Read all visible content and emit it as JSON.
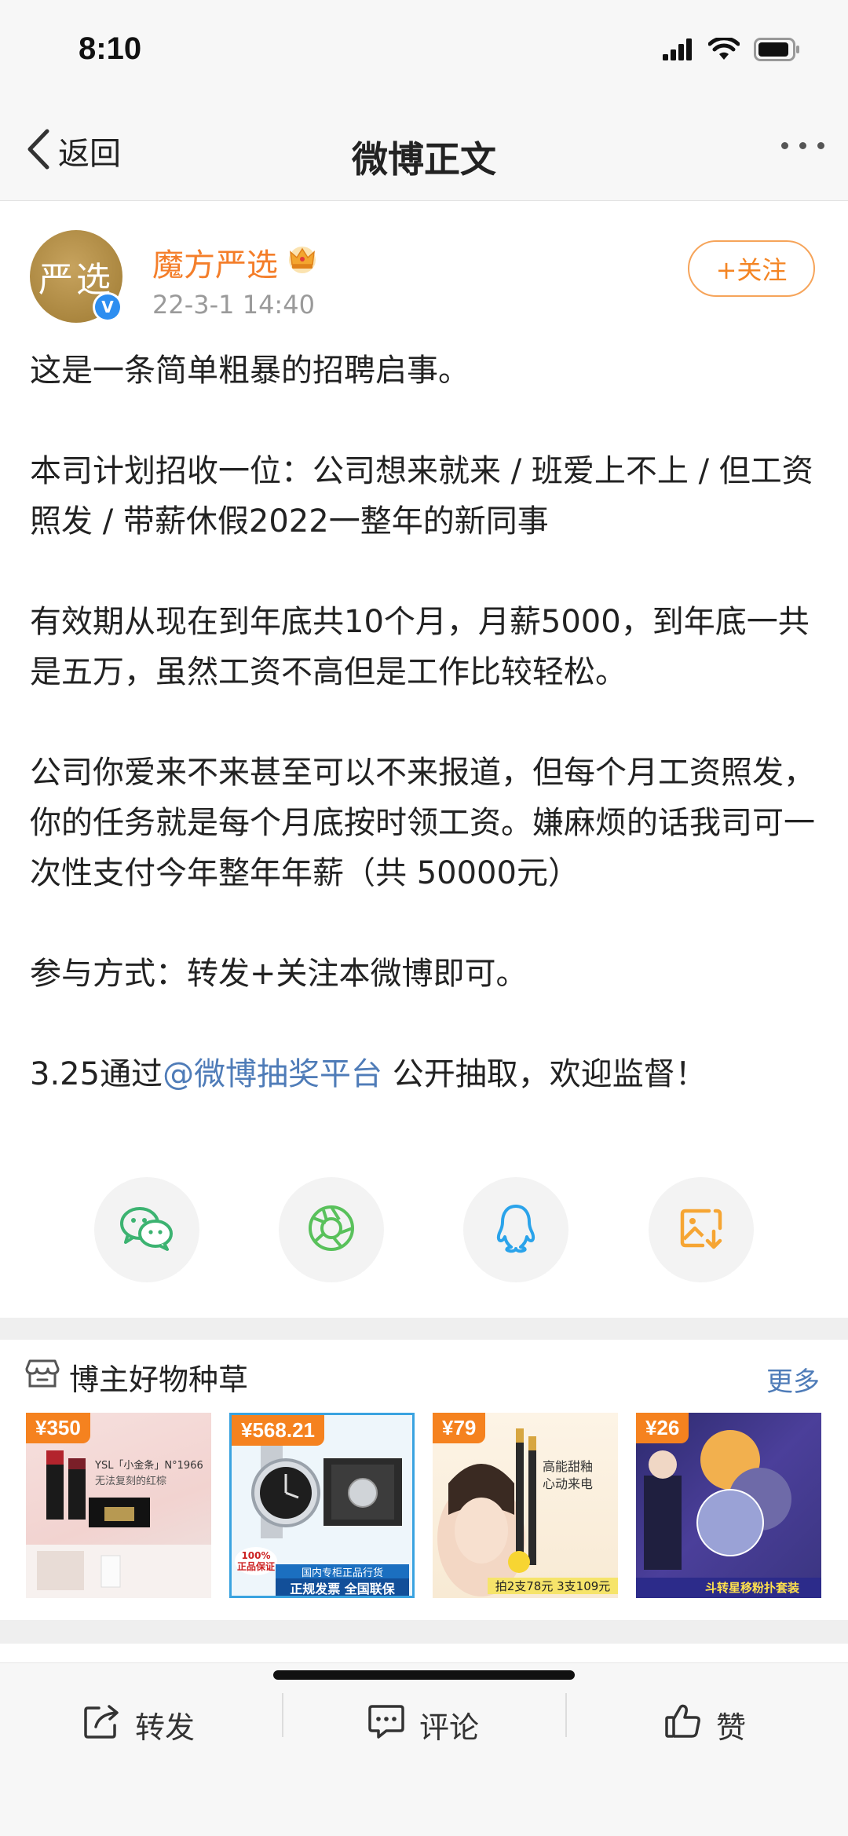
{
  "status_bar": {
    "time": "8:10"
  },
  "nav": {
    "back_label": "返回",
    "title": "微博正文"
  },
  "author": {
    "avatar_text": "严选",
    "name": "魔方严选",
    "post_time": "22-3-1 14:40",
    "follow_label": "+关注"
  },
  "post": {
    "p1": "这是一条简单粗暴的招聘启事。",
    "p2": "本司计划招收一位：公司想来就来 / 班爱上不上 / 但工资照发 / 带薪休假2022一整年的新同事",
    "p3": "有效期从现在到年底共10个月，月薪5000，到年底一共是五万，虽然工资不高但是工作比较轻松。",
    "p4": "公司你爱来不来甚至可以不来报道，但每个月工资照发，你的任务就是每个月底按时领工资。嫌麻烦的话我司可一次性支付今年整年年薪（共 50000元）",
    "p5": "参与方式：转发+关注本微博即可。",
    "p6_before": "3.25通过",
    "p6_mention": "@微博抽奖平台",
    "p6_after": " 公开抽取，欢迎监督！"
  },
  "share_icons": [
    "wechat-icon",
    "moments-icon",
    "qq-icon",
    "save-image-icon"
  ],
  "goods": {
    "title": "博主好物种草",
    "more_label": "更多",
    "items": [
      {
        "price": "¥350",
        "caption": "YSL「小金条」N°1966",
        "sub": "无法复刻的红棕"
      },
      {
        "price": "¥568.21",
        "badge": "100% 正品保证",
        "banner_top": "国内专柜正品行货",
        "banner": "正规发票 全国联保"
      },
      {
        "price": "¥79",
        "caption": "高能甜釉 心动来电",
        "banner": "拍2支78元 3支109元"
      },
      {
        "price": "¥26",
        "caption": "斗转星移粉扑套装"
      }
    ]
  },
  "toolbar": {
    "repost_label": "转发",
    "comment_label": "评论",
    "like_label": "赞"
  },
  "colors": {
    "accent_orange": "#f47e2a",
    "link_blue": "#4f7cb8",
    "price_orange": "#f5821f"
  }
}
